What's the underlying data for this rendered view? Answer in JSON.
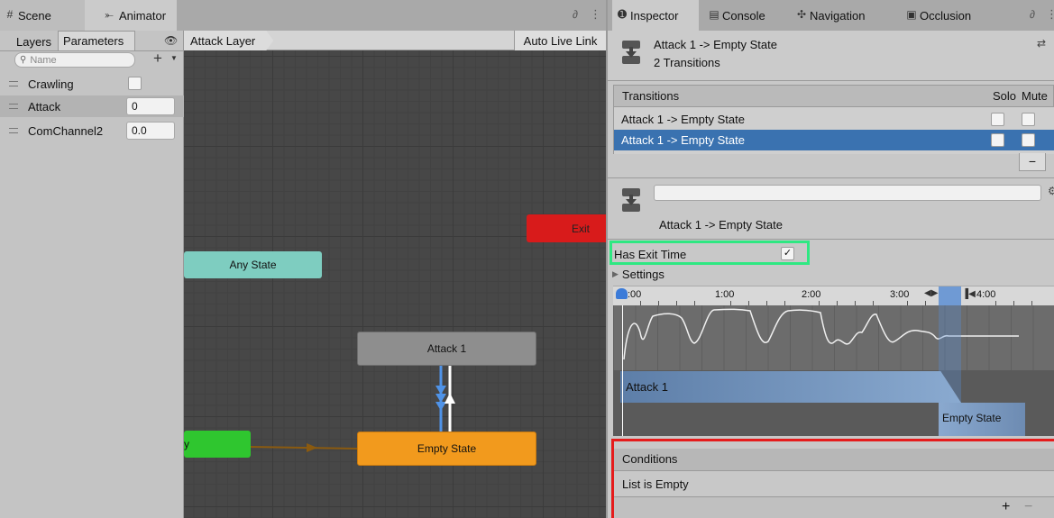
{
  "left_tabs": {
    "scene_label": "Scene",
    "animator_label": "Animator"
  },
  "params_tabs": {
    "layers": "Layers",
    "parameters": "Parameters"
  },
  "search": {
    "placeholder": "Name"
  },
  "add_button": "+",
  "parameters": [
    {
      "name": "Crawling",
      "type": "bool",
      "value": ""
    },
    {
      "name": "Attack",
      "type": "int",
      "value": "0"
    },
    {
      "name": "ComChannel2",
      "type": "float",
      "value": "0.0"
    }
  ],
  "graph": {
    "layer_breadcrumb": "Attack Layer",
    "auto_live_link": "Auto Live Link",
    "nodes": {
      "any_state": "Any State",
      "attack1": "Attack 1",
      "empty_state": "Empty State",
      "exit": "Exit",
      "entry": "y"
    },
    "colors": {
      "any_state": "#7ecdc0",
      "attack1": "#888888",
      "empty_state": "#f29a1d",
      "exit": "#d81b1b",
      "entry": "#2fc62f",
      "transition_selected": "#4f93e8"
    }
  },
  "right_tabs": {
    "inspector": "Inspector",
    "console": "Console",
    "navigation": "Navigation",
    "occlusion": "Occlusion"
  },
  "inspector": {
    "title": "Attack 1 -> Empty State",
    "subtitle": "2 Transitions",
    "transitions_header": "Transitions",
    "solo_label": "Solo",
    "mute_label": "Mute",
    "transitions": [
      {
        "label": "Attack 1 -> Empty State",
        "selected": false
      },
      {
        "label": "Attack 1 -> Empty State",
        "selected": true
      }
    ],
    "remove_button": "−",
    "name_field_value": "",
    "transition_caption": "Attack 1 -> Empty State",
    "has_exit_time_label": "Has Exit Time",
    "has_exit_time_checked": "✓",
    "settings_label": "Settings",
    "timeline_ticks": [
      ":00",
      "1:00",
      "2:00",
      "3:00",
      "4:00"
    ],
    "clip_from": "Attack 1",
    "clip_to": "Empty State",
    "conditions_header": "Conditions",
    "conditions_empty": "List is Empty",
    "conditions_add": "+",
    "conditions_remove": "−"
  }
}
